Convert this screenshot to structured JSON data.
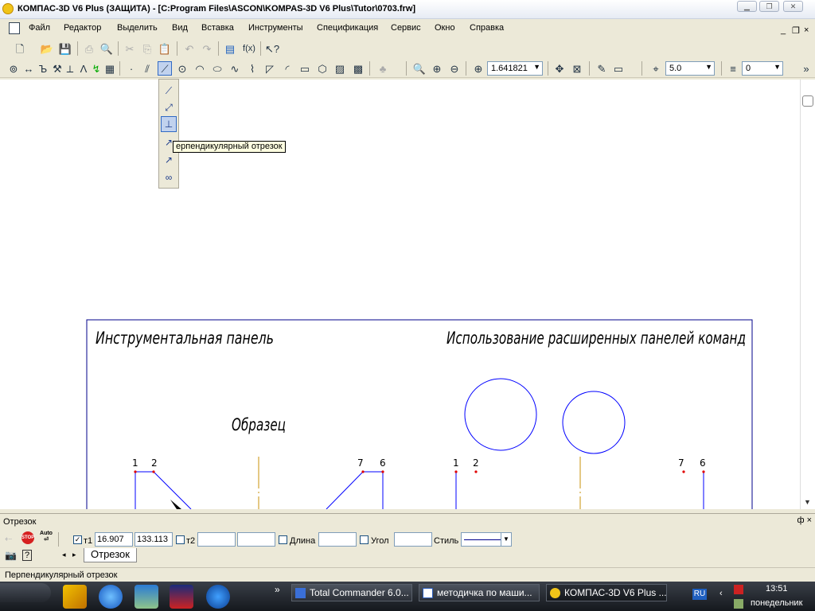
{
  "window": {
    "title": "КОМПАС-3D V6 Plus (ЗАЩИТА) - [C:Program Files\\ASCON\\KOMPAS-3D V6 Plus\\Tutor\\0703.frw]",
    "minimize_icon": "minimize-icon",
    "maximize_icon": "maximize-icon",
    "close_label": "✕"
  },
  "menu": {
    "items": [
      "Файл",
      "Редактор",
      "Выделить",
      "Вид",
      "Вставка",
      "Инструменты",
      "Спецификация",
      "Сервис",
      "Окно",
      "Справка"
    ],
    "mdi_minimize": "_",
    "mdi_restore": "❐",
    "mdi_close": "×"
  },
  "toolbar": {
    "fx_label": "f(x)",
    "zoom_value": "1.641821",
    "step_value": "5.0",
    "layer_value": "0"
  },
  "flyout": {
    "tooltip": "ерпендикулярный отрезок",
    "items": [
      "segment-icon",
      "parallel-segment-icon",
      "perpendicular-segment-icon",
      "tangent-segment-icon",
      "tangent-segment-2-icon",
      "bisector-segment-icon"
    ]
  },
  "drawing": {
    "title_left": "Инструментальная панель",
    "title_right": "Использование расширенных панелей команд",
    "sample_label": "Образец",
    "point_labels": [
      "1",
      "2",
      "7",
      "6",
      "1",
      "2",
      "7",
      "6"
    ]
  },
  "properties": {
    "panel_title": "Отрезок",
    "pin_label": "ф",
    "close_label": "×",
    "stop_label": "STOP",
    "auto_label": "Auto",
    "t1_label": "т1",
    "t1_x": "16.907",
    "t1_y": "133.113",
    "t2_label": "т2",
    "length_label": "Длина",
    "angle_label": "Угол",
    "style_label": "Стиль",
    "tab_label": "Отрезок",
    "checked_mark": "✓"
  },
  "status": {
    "text": "Перпендикулярный отрезок"
  },
  "taskbar": {
    "overflow": "»",
    "tasks": [
      {
        "label": "Total Commander 6.0..."
      },
      {
        "label": "методичка по маши..."
      },
      {
        "label": "КОМПАС-3D V6 Plus ..."
      }
    ],
    "lang": "RU",
    "time": "13:51",
    "day": "понедельник"
  },
  "colors": {
    "drawing_blue": "#0000ff",
    "axis_orange": "#c8900a",
    "point_red": "#e00000"
  }
}
